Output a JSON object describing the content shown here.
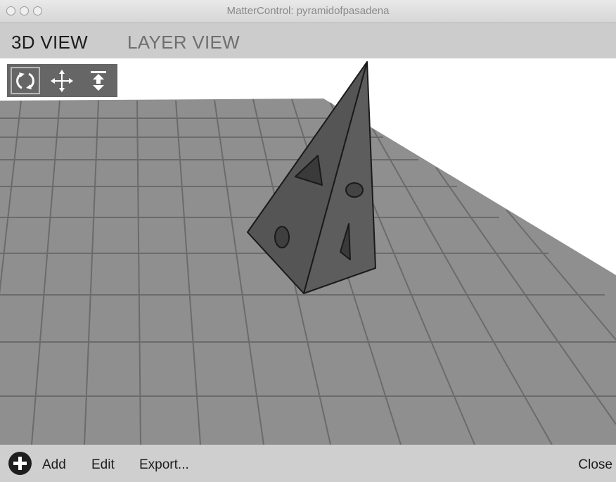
{
  "window": {
    "title": "MatterControl: pyramidofpasadena"
  },
  "tabs": [
    {
      "label": "3D VIEW",
      "active": true
    },
    {
      "label": "LAYER VIEW",
      "active": false
    }
  ],
  "toolbar": {
    "tools": [
      {
        "icon": "rotate-icon",
        "selected": true
      },
      {
        "icon": "move-icon",
        "selected": false
      },
      {
        "icon": "scale-icon",
        "selected": false
      }
    ]
  },
  "bottom": {
    "add_label": "Add",
    "edit_label": "Edit",
    "export_label": "Export...",
    "close_label": "Close"
  },
  "colors": {
    "bed": "#8f8f8f",
    "grid": "#6a6a6a",
    "model": "#555555",
    "toolbar_bg": "#666666",
    "tabbar_bg": "#cccccc"
  }
}
